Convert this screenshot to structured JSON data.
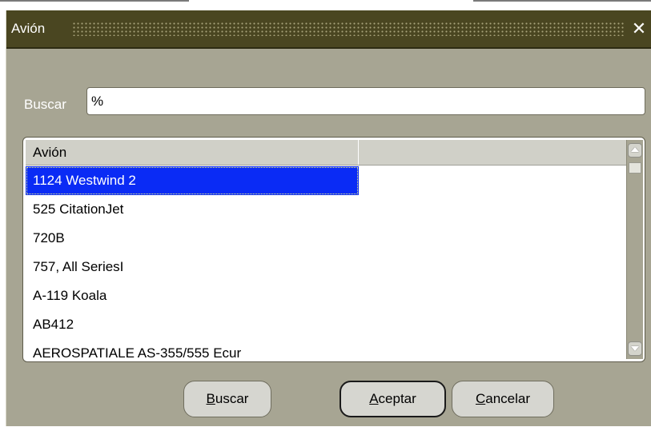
{
  "dialog": {
    "title": "Avión",
    "close_glyph": "✕"
  },
  "search": {
    "label": "Buscar",
    "value": "%"
  },
  "list": {
    "column_header": "Avión",
    "selected_index": 0,
    "rows": [
      "1124 Westwind 2",
      "525 CitationJet",
      "720B",
      "757, All SeriesI",
      "A-119 Koala",
      "AB412",
      "AEROSPATIALE AS-355/555 Ecur"
    ]
  },
  "buttons": {
    "buscar": {
      "mnemonic": "B",
      "rest": "uscar"
    },
    "aceptar": {
      "mnemonic": "A",
      "rest": "ceptar"
    },
    "cancelar": {
      "mnemonic": "C",
      "rest": "ancelar"
    }
  },
  "colors": {
    "titlebar": "#4a4621",
    "dialog_bg": "#a7a593",
    "selection": "#0a2bf5"
  },
  "icons": {
    "close": "close-icon",
    "scroll_up": "scroll-up-arrow-icon",
    "scroll_down": "scroll-down-arrow-icon"
  }
}
